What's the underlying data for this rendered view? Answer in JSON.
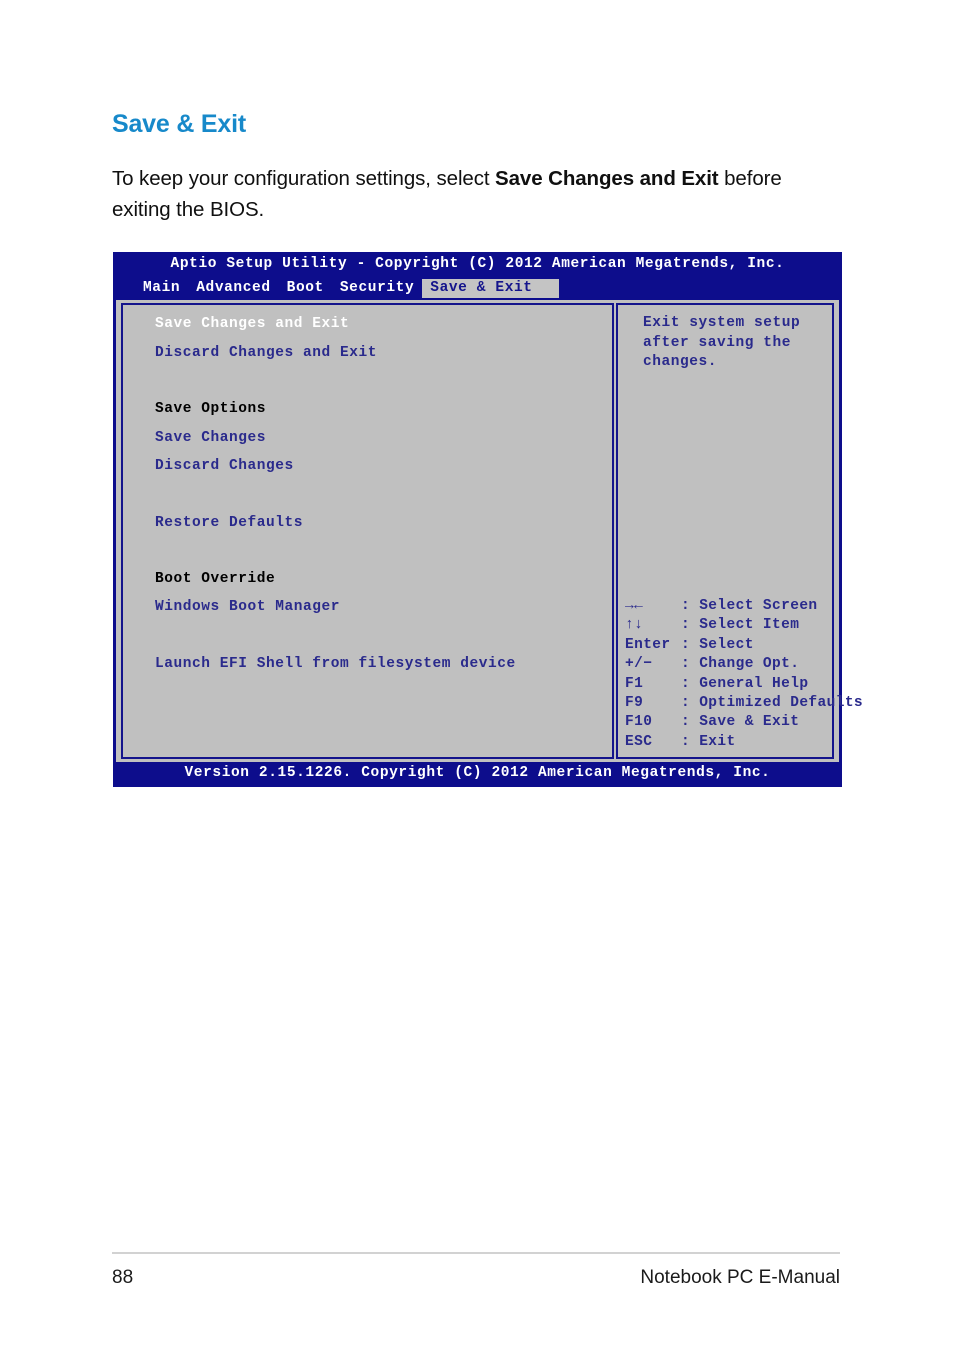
{
  "page": {
    "heading": "Save & Exit",
    "paragraph_before_bold": "To keep your configuration settings, select ",
    "paragraph_bold": "Save Changes and Exit",
    "paragraph_after_bold": " before exiting the BIOS.",
    "accent_color": "#1789CA"
  },
  "bios": {
    "title": "Aptio Setup Utility - Copyright (C) 2012 American Megatrends, Inc.",
    "version": "Version 2.15.1226. Copyright (C) 2012 American Megatrends, Inc.",
    "background_color": "#0D0D8C",
    "panel_color": "#C0C0C0",
    "border_color": "#14148C",
    "selected_text_color": "#FFFFFF",
    "item_text_color": "#2A2A8C",
    "tabs": [
      {
        "label": "Main",
        "active": false
      },
      {
        "label": "Advanced",
        "active": false
      },
      {
        "label": "Boot",
        "active": false
      },
      {
        "label": "Security",
        "active": false
      },
      {
        "label": "Save & Exit",
        "active": true
      }
    ],
    "menu_items": [
      {
        "label": "Save Changes and Exit",
        "type": "selected"
      },
      {
        "label": "Discard Changes and Exit",
        "type": "item"
      },
      {
        "label": "Save Options",
        "type": "section"
      },
      {
        "label": "Save Changes",
        "type": "item"
      },
      {
        "label": "Discard Changes",
        "type": "item"
      },
      {
        "label": "Restore Defaults",
        "type": "item"
      },
      {
        "label": "Boot Override",
        "type": "section"
      },
      {
        "label": "Windows Boot Manager",
        "type": "item"
      },
      {
        "label": "Launch EFI Shell from filesystem device",
        "type": "item"
      }
    ],
    "help": {
      "line1": "Exit system setup",
      "line2": "after saving the",
      "line3": "changes."
    },
    "legend": [
      {
        "key": "→←",
        "sep": ": ",
        "action": "Select Screen"
      },
      {
        "key": "↑↓",
        "sep": ": ",
        "action": "Select Item"
      },
      {
        "key": "Enter",
        "sep": ": ",
        "action": "Select"
      },
      {
        "key": "+/−",
        "sep": ": ",
        "action": "Change Opt."
      },
      {
        "key": "F1",
        "sep": ": ",
        "action": "General Help"
      },
      {
        "key": "F9",
        "sep": ": ",
        "action": "Optimized Defaults"
      },
      {
        "key": "F10",
        "sep": ": ",
        "action": "Save & Exit"
      },
      {
        "key": "ESC",
        "sep": ": ",
        "action": "Exit"
      }
    ]
  },
  "footer": {
    "page_number": "88",
    "document_title": "Notebook PC E-Manual"
  }
}
